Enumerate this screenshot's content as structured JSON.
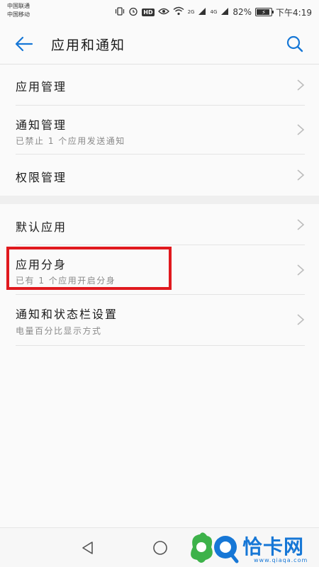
{
  "status_bar": {
    "carrier_1": "中国联通",
    "carrier_2": "中国移动",
    "network_1": "2G",
    "network_2": "4G",
    "battery": "82%",
    "battery_fraction": 0.82,
    "time": "下午4:19",
    "hd_label": "HD",
    "icons": [
      "vibrate-icon",
      "alarm-icon",
      "hd-icon",
      "eye-icon",
      "wifi-icon",
      "signal-icon",
      "signal-icon",
      "battery-icon"
    ]
  },
  "app_bar": {
    "title": "应用和通知",
    "back_icon": "arrow-left-icon",
    "search_icon": "search-icon",
    "accent_color": "#1677d6"
  },
  "list": {
    "group1": [
      {
        "title": "应用管理",
        "subtitle": ""
      },
      {
        "title": "通知管理",
        "subtitle": "已禁止 1 个应用发送通知"
      },
      {
        "title": "权限管理",
        "subtitle": ""
      }
    ],
    "group2": [
      {
        "title": "默认应用",
        "subtitle": ""
      },
      {
        "title": "应用分身",
        "subtitle": "已有 1 个应用开启分身"
      },
      {
        "title": "通知和状态栏设置",
        "subtitle": "电量百分比显示方式"
      }
    ]
  },
  "highlight_color": "#e0191e",
  "nav_bar": {
    "icons": [
      "triangle-back-icon",
      "circle-home-icon"
    ]
  },
  "watermark": {
    "text": "恰卡网",
    "url": "www.qiaqa.com",
    "color": "#1677d6"
  }
}
